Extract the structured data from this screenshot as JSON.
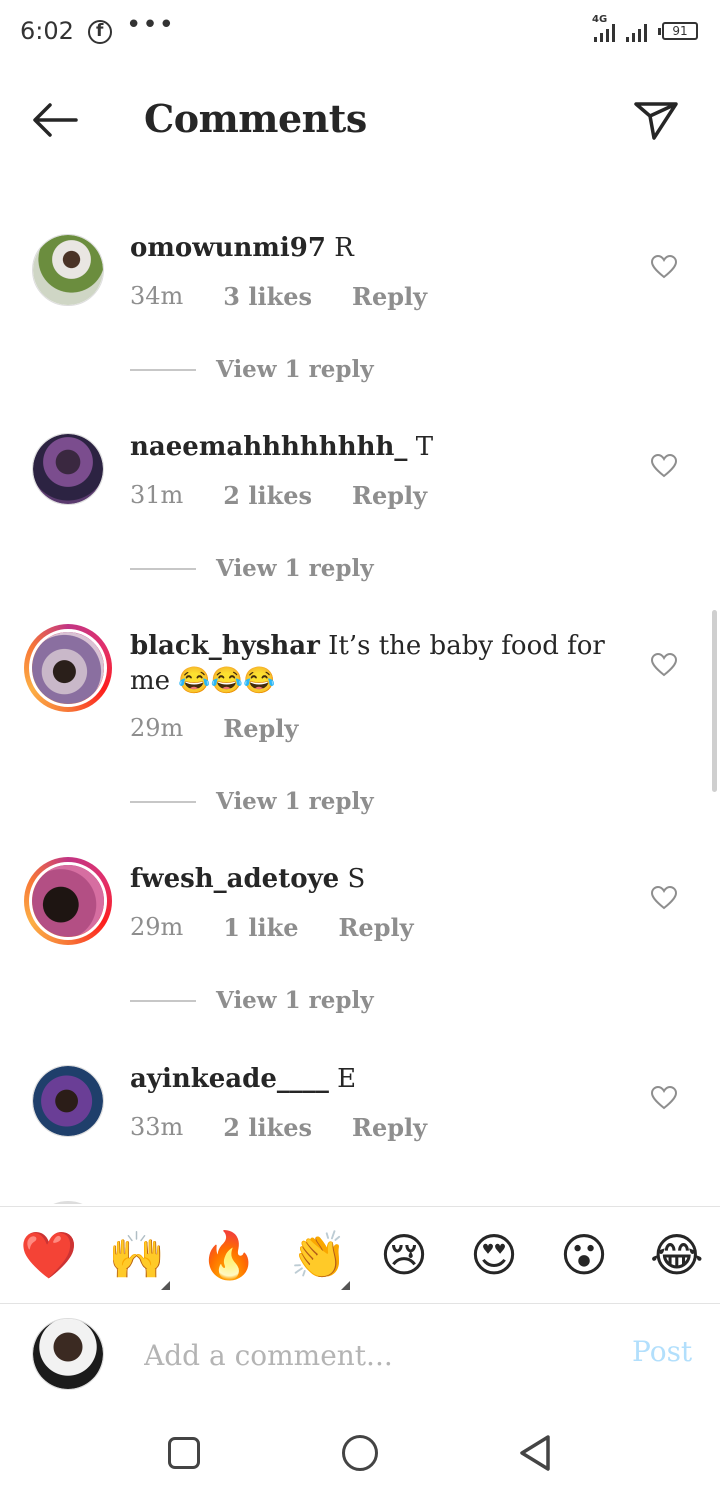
{
  "status_bar": {
    "time": "6:02",
    "network": "4G",
    "battery": "91",
    "icons": [
      "facebook-icon",
      "more-dots-icon",
      "signal-icon",
      "battery-icon"
    ]
  },
  "header": {
    "title": "Comments",
    "icons": [
      "back-arrow-icon",
      "send-icon"
    ]
  },
  "comments": [
    {
      "username": "omowunmi97",
      "text": "R",
      "time": "34m",
      "likes": "3 likes",
      "reply": "Reply",
      "view_replies": "View 1 reply",
      "story_ring": false
    },
    {
      "username": "naeemahhhhhhhh_",
      "text": "T",
      "time": "31m",
      "likes": "2 likes",
      "reply": "Reply",
      "view_replies": "View 1 reply",
      "story_ring": false
    },
    {
      "username": "black_hyshar",
      "text": "It’s the baby food for me 😂😂😂",
      "time": "29m",
      "likes": "",
      "reply": "Reply",
      "view_replies": "View 1 reply",
      "story_ring": true
    },
    {
      "username": "fwesh_adetoye",
      "text": "S",
      "time": "29m",
      "likes": "1 like",
      "reply": "Reply",
      "view_replies": "View 1 reply",
      "story_ring": true
    },
    {
      "username": "ayinkeade____",
      "text": "E",
      "time": "33m",
      "likes": "2 likes",
      "reply": "Reply",
      "view_replies": "",
      "story_ring": false
    }
  ],
  "emoji_bar": [
    "❤️",
    "🙌",
    "🔥",
    "👏",
    "😢",
    "😍",
    "😮",
    "😂"
  ],
  "composer": {
    "placeholder": "Add a comment...",
    "post_label": "Post"
  },
  "colors": {
    "text": "#262626",
    "secondary": "#8e8e8e",
    "post_disabled": "#b2dffc",
    "story_ring": [
      "#c13584",
      "#fd1d1d",
      "#fcaf45"
    ]
  }
}
